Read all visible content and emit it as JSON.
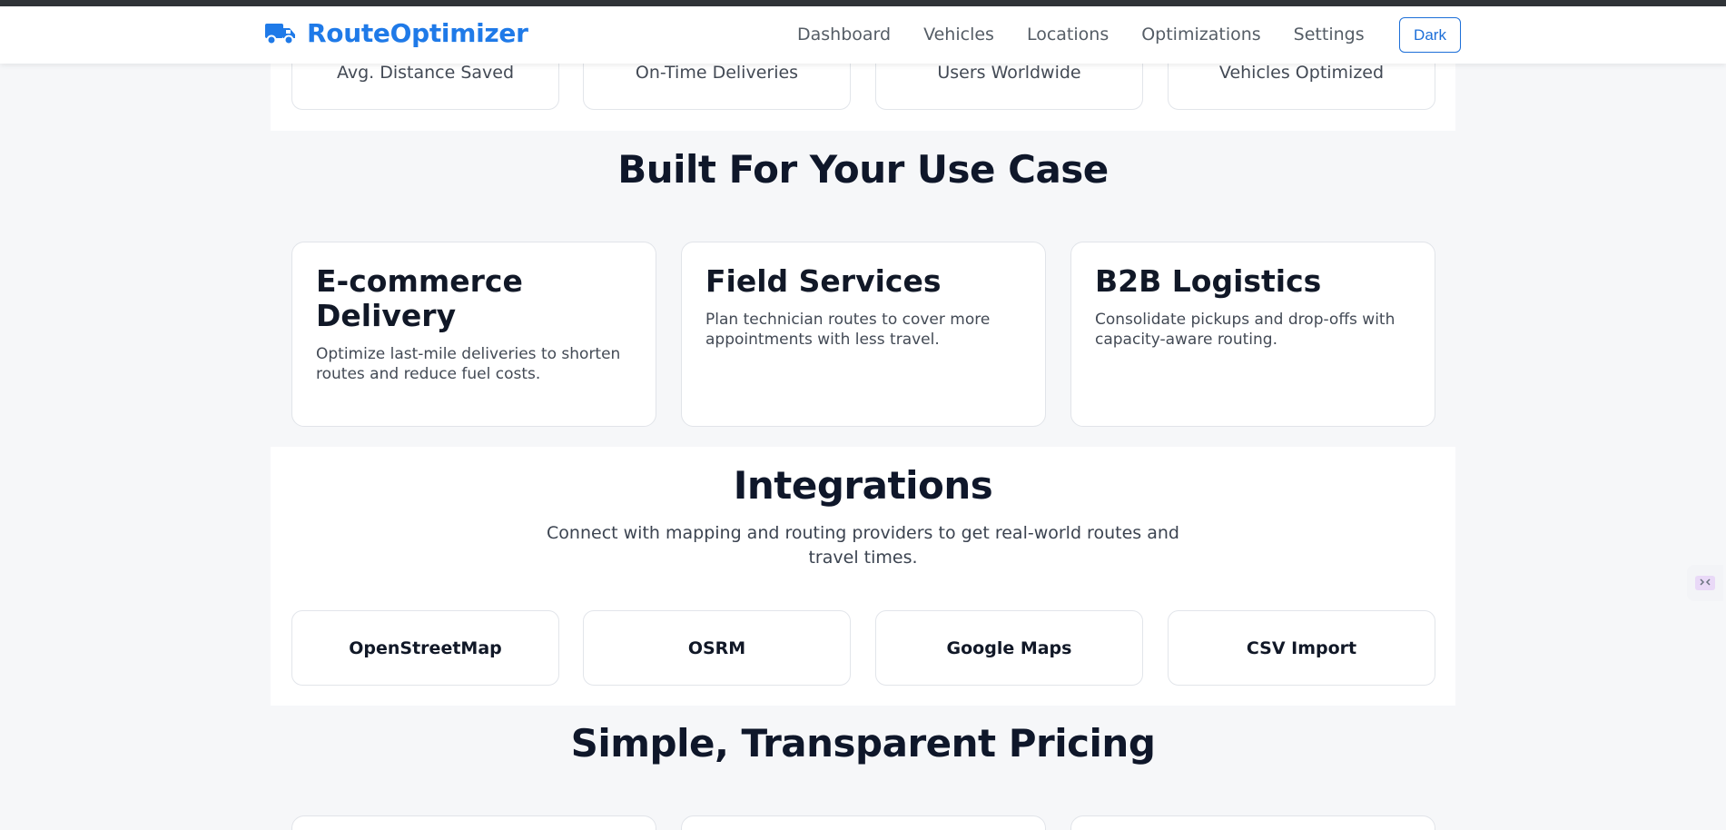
{
  "brand": {
    "name": "RouteOptimizer",
    "icon": "truck-icon",
    "color": "#1f7ae8"
  },
  "nav": {
    "links": [
      "Dashboard",
      "Vehicles",
      "Locations",
      "Optimizations",
      "Settings"
    ],
    "theme_button": "Dark"
  },
  "stats": {
    "items": [
      {
        "label": "Avg. Distance Saved"
      },
      {
        "label": "On-Time Deliveries"
      },
      {
        "label": "Users Worldwide"
      },
      {
        "label": "Vehicles Optimized"
      }
    ]
  },
  "use_cases": {
    "title": "Built For Your Use Case",
    "items": [
      {
        "title": "E-commerce Delivery",
        "description": "Optimize last-mile deliveries to shorten routes and reduce fuel costs."
      },
      {
        "title": "Field Services",
        "description": "Plan technician routes to cover more appointments with less travel."
      },
      {
        "title": "B2B Logistics",
        "description": "Consolidate pickups and drop-offs with capacity-aware routing."
      }
    ]
  },
  "integrations": {
    "title": "Integrations",
    "subtitle": "Connect with mapping and routing providers to get real-world routes and travel times.",
    "items": [
      "OpenStreetMap",
      "OSRM",
      "Google Maps",
      "CSV Import"
    ]
  },
  "pricing": {
    "title": "Simple, Transparent Pricing"
  },
  "side_widget": {
    "icon": "code-widget-icon"
  }
}
